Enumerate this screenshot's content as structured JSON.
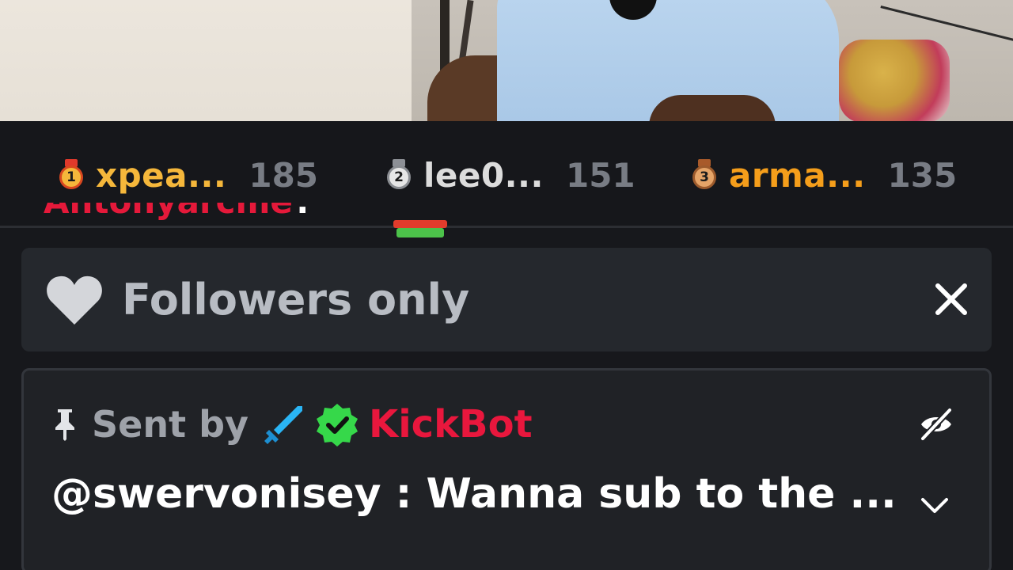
{
  "leaderboard": {
    "entries": [
      {
        "rank": "1",
        "name": "xpea...",
        "score": "185",
        "color": "#f5b73b"
      },
      {
        "rank": "2",
        "name": "lee0...",
        "score": "151",
        "color": "#dcdcdc"
      },
      {
        "rank": "3",
        "name": "arma...",
        "score": "135",
        "color": "#f59e1b"
      }
    ]
  },
  "chat_cut": {
    "username": "Antonyarcme",
    "colon": ":"
  },
  "followers_banner": {
    "label": "Followers only",
    "icon": "heart-icon",
    "close_icon": "close-icon"
  },
  "pinned_message": {
    "sent_by_label": "Sent by",
    "author": "KickBot",
    "author_color": "#e9173d",
    "badges": [
      "sword-icon",
      "verified-icon"
    ],
    "message": "@swervonisey : Wanna sub to the ...",
    "hide_icon": "eye-off-icon",
    "expand_icon": "chevron-down-icon"
  }
}
